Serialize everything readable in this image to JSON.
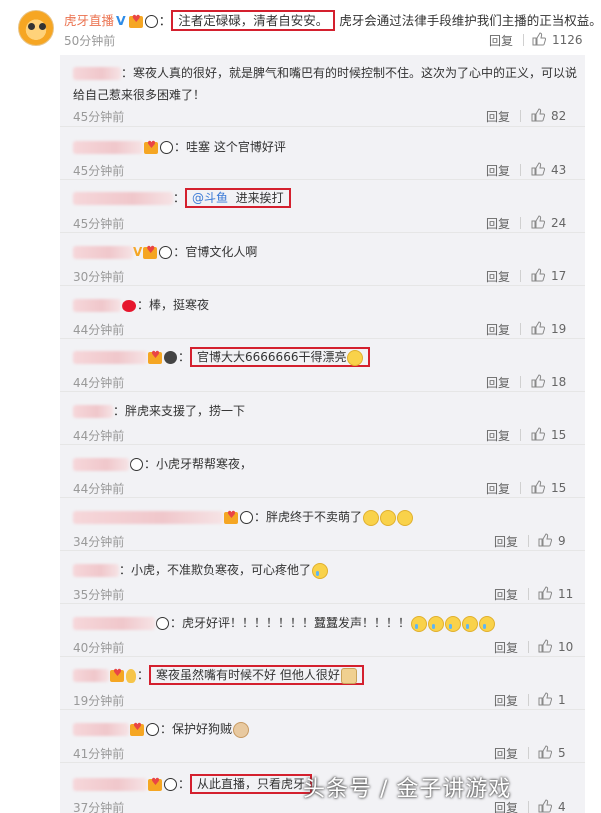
{
  "post": {
    "author": "虎牙直播",
    "quote": "注者定碌碌，清者自安安。",
    "text": "虎牙会通过法律手段维护我们主播的正当权益。",
    "time": "50分钟前",
    "reply_label": "回复",
    "likes": "1126"
  },
  "replies": [
    {
      "text1": "寒夜人真的很好，就是脾气和嘴巴有的时候控制不住。这次为了心中的正义，可以说",
      "text2": "给自己惹来很多困难了！",
      "time": "45分钟前",
      "reply": "回复",
      "likes": "82"
    },
    {
      "text1": "哇塞 这个官博好评",
      "time": "45分钟前",
      "reply": "回复",
      "likes": "43"
    },
    {
      "mention": "@斗鱼",
      "text1": "进来挨打",
      "time": "45分钟前",
      "reply": "回复",
      "likes": "24"
    },
    {
      "text1": "官博文化人啊",
      "time": "30分钟前",
      "reply": "回复",
      "likes": "17"
    },
    {
      "text1": "棒，挺寒夜",
      "time": "44分钟前",
      "reply": "回复",
      "likes": "19"
    },
    {
      "text1": "官博大大6666666干得漂亮",
      "time": "44分钟前",
      "reply": "回复",
      "likes": "18"
    },
    {
      "text1": "胖虎来支援了，捞一下",
      "time": "44分钟前",
      "reply": "回复",
      "likes": "15"
    },
    {
      "text1": "小虎牙帮帮寒夜，",
      "time": "44分钟前",
      "reply": "回复",
      "likes": "15"
    },
    {
      "text1": "胖虎终于不卖萌了",
      "time": "34分钟前",
      "reply": "回复",
      "likes": "9"
    },
    {
      "text1": "小虎，不准欺负寒夜，可心疼他了",
      "time": "35分钟前",
      "reply": "回复",
      "likes": "11"
    },
    {
      "text1": "虎牙好评！！！！！！！蠶蠶发声！！！！",
      "time": "40分钟前",
      "reply": "回复",
      "likes": "10"
    },
    {
      "text1": "寒夜虽然嘴有时候不好 但他人很好",
      "time": "19分钟前",
      "reply": "回复",
      "likes": "1"
    },
    {
      "text1": "保护好狗贼",
      "time": "41分钟前",
      "reply": "回复",
      "likes": "5"
    },
    {
      "text1": "从此直播，只看虎牙",
      "time": "37分钟前",
      "reply": "回复",
      "likes": "4"
    }
  ],
  "watermark": "头条号 / 金子讲游戏",
  "icons": {
    "avatar": "tiger-avatar-icon",
    "verified": "verified-v-icon",
    "like": "thumbs-up-icon",
    "panda": "panda-emoji-icon"
  },
  "colors": {
    "author": "#eb7350",
    "highlight": "#d4202e",
    "mention": "#3b7ad6",
    "reply_bg": "#f2f2f5"
  }
}
